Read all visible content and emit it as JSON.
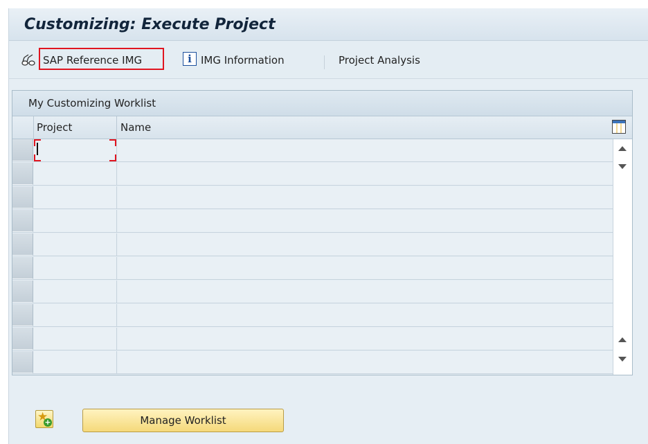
{
  "window": {
    "title": "Customizing: Execute Project"
  },
  "toolbar": {
    "items": [
      {
        "label": "SAP Reference IMG",
        "icon": "glasses-icon",
        "highlighted": true,
        "highlight_color": "#e0141f"
      },
      {
        "label": "IMG Information",
        "icon": "info-icon",
        "icon_glyph": "i"
      },
      {
        "label": "Project Analysis"
      }
    ]
  },
  "worklist": {
    "title": "My Customizing Worklist",
    "columns": [
      "Project",
      "Name"
    ],
    "settings_icon": "table-layout-icon",
    "rows": [
      {
        "project": "",
        "name": ""
      },
      {
        "project": "",
        "name": ""
      },
      {
        "project": "",
        "name": ""
      },
      {
        "project": "",
        "name": ""
      },
      {
        "project": "",
        "name": ""
      },
      {
        "project": "",
        "name": ""
      },
      {
        "project": "",
        "name": ""
      },
      {
        "project": "",
        "name": ""
      },
      {
        "project": "",
        "name": ""
      },
      {
        "project": "",
        "name": ""
      }
    ]
  },
  "actions": {
    "add_favorite_icon": "star-add-icon",
    "manage_label": "Manage Worklist"
  },
  "colors": {
    "highlight": "#e0141f",
    "button_yellow": "#f5d97a",
    "background": "#e6eef4"
  }
}
